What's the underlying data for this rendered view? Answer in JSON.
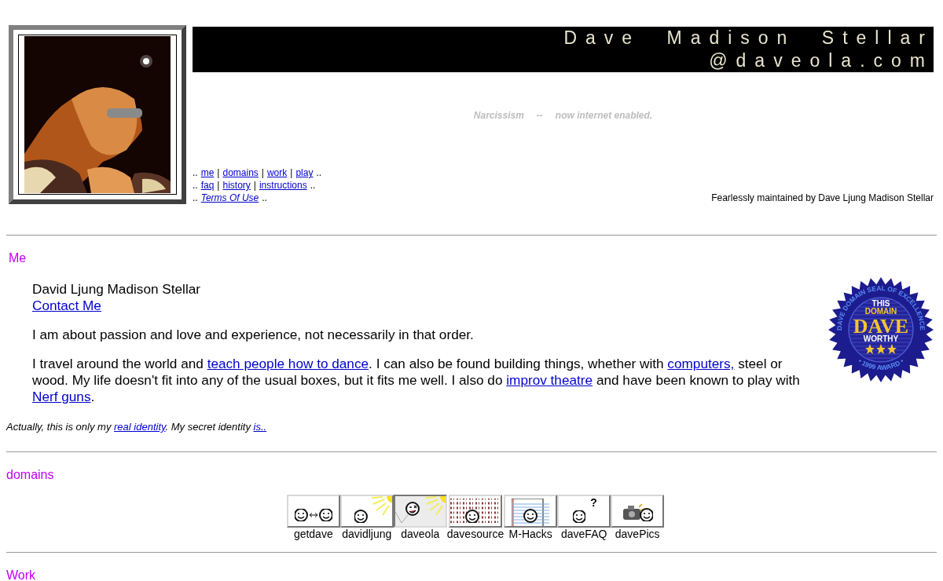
{
  "header": {
    "photo": {
      "kind": "picture"
    },
    "title_lines": [
      "Dave Madison Stellar",
      "@daveola.com"
    ],
    "tagline": [
      "Narcissism",
      "--",
      "now internet enabled."
    ],
    "nav": [
      {
        "lead": "..",
        "trail": "..",
        "separator": "|",
        "links": [
          {
            "text": "me",
            "italic": false
          },
          {
            "text": "domains",
            "italic": false
          },
          {
            "text": "work",
            "italic": false
          },
          {
            "text": "play",
            "italic": false
          }
        ]
      },
      {
        "lead": "..",
        "trail": "..",
        "separator": "|",
        "links": [
          {
            "text": "faq",
            "italic": false
          },
          {
            "text": "history",
            "italic": false
          },
          {
            "text": "instructions",
            "italic": false
          }
        ]
      },
      {
        "lead": "..",
        "trail": "..",
        "links": [
          {
            "text": "Terms Of Use",
            "italic": true
          }
        ]
      }
    ],
    "maintainer": "Fearlessly maintained by Dave Ljung Madison Stellar"
  },
  "sections": [
    {
      "kind": "me",
      "heading": "Me",
      "name": "David Ljung Madison Stellar",
      "contact": "Contact Me",
      "paragraphs": [
        [
          {
            "kind": "text",
            "text": "I am about passion and love and experience, not necessarily in that order."
          }
        ],
        [
          {
            "kind": "text",
            "text": "I travel around the world and "
          },
          {
            "kind": "link",
            "text": "teach people how to dance"
          },
          {
            "kind": "text",
            "text": ". I can also be found building things, whether with "
          },
          {
            "kind": "link",
            "text": "computers,"
          },
          {
            "kind": "text",
            "text": " steel or wood. My life doesn't fit into any of the usual boxes, but it fits me well. I also do "
          },
          {
            "kind": "link",
            "text": "improv theatre"
          },
          {
            "kind": "text",
            "text": " and have been known to play with "
          },
          {
            "kind": "link",
            "text": "Nerf guns"
          },
          {
            "kind": "text",
            "text": "."
          }
        ]
      ],
      "seal": {
        "ring_top": "DAVE DOMAIN SEAL OF EXCELLENCE",
        "ring_bottom": "• 1999 AWARD •",
        "line_1": "THIS",
        "line_2": "DOMAIN",
        "big": "DAVE",
        "line_3": "WORTHY",
        "stars": 3
      },
      "footnote": [
        {
          "kind": "text",
          "text": "Actually, this is only my "
        },
        {
          "kind": "link",
          "text": "real identity"
        },
        {
          "kind": "text",
          "text": ". My secret identity "
        },
        {
          "kind": "link",
          "text": "is.."
        }
      ]
    },
    {
      "kind": "domains",
      "heading": "domains",
      "tiles": [
        {
          "label": "getdave",
          "kind": "arrows",
          "selected": false
        },
        {
          "label": "davidljung",
          "kind": "sun",
          "selected": false
        },
        {
          "label": "daveola",
          "kind": "wink",
          "selected": true
        },
        {
          "label": "davesource",
          "kind": "binary",
          "selected": false
        },
        {
          "label": "M-Hacks",
          "kind": "notepad",
          "selected": false
        },
        {
          "label": "daveFAQ",
          "kind": "question",
          "mark": "?",
          "selected": false
        },
        {
          "label": "davePics",
          "kind": "camera",
          "selected": false
        }
      ]
    },
    {
      "kind": "heading_only",
      "heading": "Work"
    }
  ]
}
